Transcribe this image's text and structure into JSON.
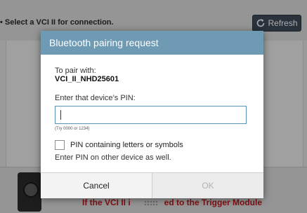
{
  "topbar": {
    "instruction": "Select a VCI II for connection.",
    "refresh_label": "Refresh"
  },
  "dialog": {
    "title": "Bluetooth pairing request",
    "pair_label": "To pair with:",
    "device_name": "VCI_II_NHD25601",
    "pin_label": "Enter that device’s PIN:",
    "pin_value": "",
    "pin_hint": "(Try 0000 or 1234)",
    "checkbox_label": "PIN containing letters or symbols",
    "checkbox_checked": false,
    "note": "Enter PIN on other device as well.",
    "cancel_label": "Cancel",
    "ok_label": "OK"
  },
  "background": {
    "warning_left": "If the VCI II i",
    "warning_right": "ed to the Trigger Module"
  },
  "colors": {
    "dialog_header": "#6f9ab3",
    "refresh_button": "#3f4a59",
    "warning_text": "#c0191e",
    "input_border": "#5a92bb"
  },
  "icons": {
    "refresh": "refresh-icon",
    "device": "device-icon",
    "grip": "grip-icon"
  }
}
